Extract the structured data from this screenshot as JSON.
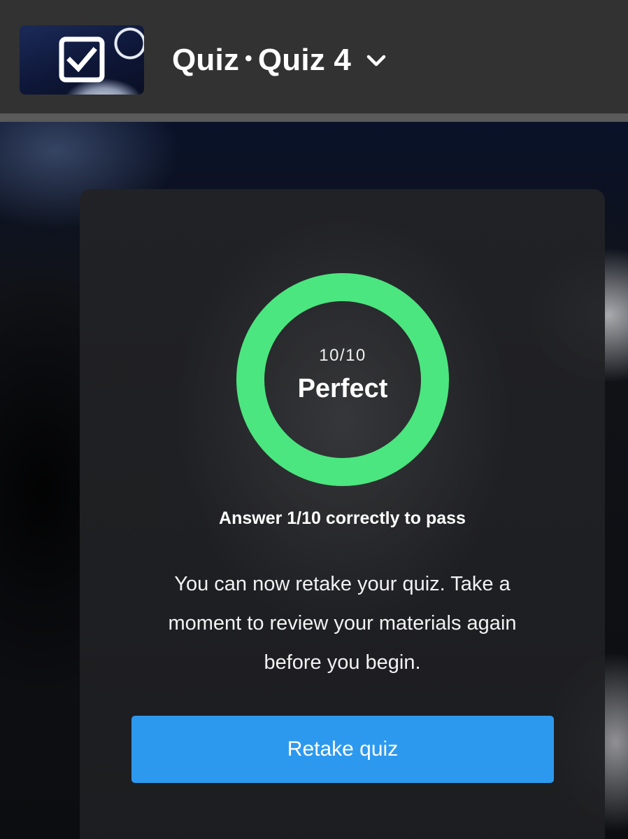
{
  "header": {
    "thumbnail_icon": "checkbox-check-icon",
    "title_part1": "Quiz",
    "separator": "•",
    "title_part2": "Quiz 4",
    "dropdown_icon": "chevron-down-icon"
  },
  "result": {
    "score_fraction": "10/10",
    "score_label": "Perfect",
    "progress": 1.0,
    "ring_color": "#4be67f",
    "pass_requirement": "Answer 1/10 correctly to pass",
    "description": "You can now retake your quiz. Take a moment to review your materials again before you begin.",
    "retake_button_label": "Retake quiz",
    "button_color": "#2d99ee"
  }
}
